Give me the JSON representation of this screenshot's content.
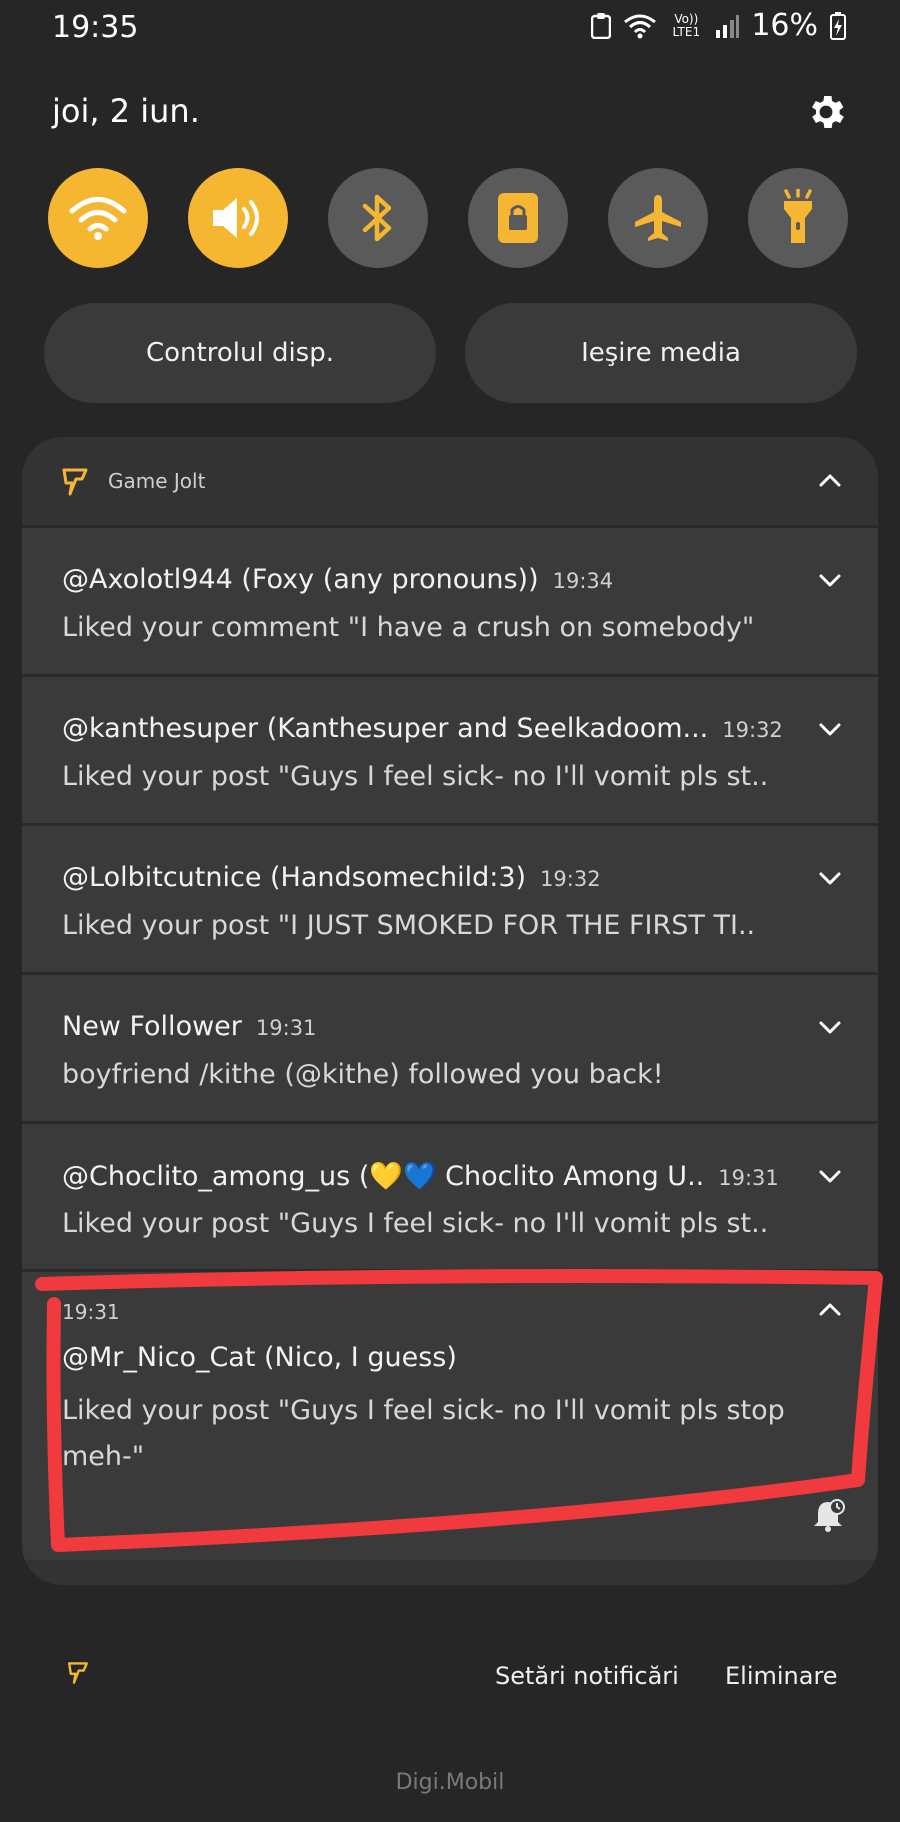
{
  "status_bar": {
    "time": "19:35",
    "network_label": "Vo)) LTE1",
    "battery": "16%"
  },
  "header": {
    "date": "joi, 2 iun."
  },
  "quick_toggles": [
    {
      "name": "wifi",
      "state": "on"
    },
    {
      "name": "sound",
      "state": "on"
    },
    {
      "name": "bluetooth",
      "state": "off"
    },
    {
      "name": "rotation-lock",
      "state": "off"
    },
    {
      "name": "airplane-mode",
      "state": "off"
    },
    {
      "name": "flashlight",
      "state": "off"
    }
  ],
  "pills": {
    "device_control": "Controlul disp.",
    "media_output": "Ieşire media"
  },
  "notifications": {
    "app_name": "Game Jolt",
    "items": [
      {
        "title": "@Axolotl944 (Foxy (any pronouns))",
        "time": "19:34",
        "body": "Liked your comment \"I have a crush on somebody\""
      },
      {
        "title": "@kanthesuper (Kanthesuper and Seelkadoom...",
        "time": "19:32",
        "body": "Liked your post \"Guys I feel sick- no I'll vomit pls st.."
      },
      {
        "title": "@Lolbitcutnice (Handsomechild:3)",
        "time": "19:32",
        "body": "Liked your post \"I JUST SMOKED FOR THE FIRST TI.."
      },
      {
        "title": "New Follower",
        "time": "19:31",
        "body": "boyfriend /kithe (@kithe) followed you back!"
      },
      {
        "title": "@Choclito_among_us (💛💙 Choclito Among U..",
        "time": "19:31",
        "body": "Liked your post \"Guys I feel sick- no I'll vomit pls st.."
      }
    ],
    "expanded": {
      "time": "19:31",
      "title": "@Mr_Nico_Cat (Nico, I guess)",
      "body": "Liked your post \"Guys I feel sick- no I'll vomit pls stop meh-\""
    }
  },
  "bottom_bar": {
    "settings_label": "Setări notificări",
    "clear_label": "Eliminare"
  },
  "carrier": "Digi.Mobil",
  "colors": {
    "accent": "#f5b731",
    "highlight": "#f03a3e",
    "background": "#262626"
  }
}
